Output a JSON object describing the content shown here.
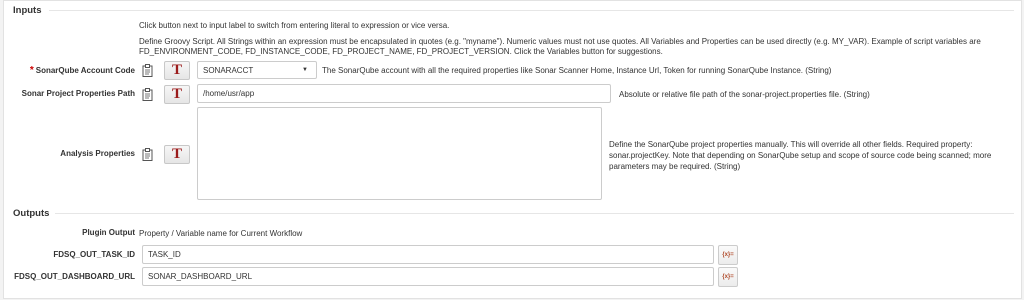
{
  "inputs": {
    "title": "Inputs",
    "help_line1": "Click button next to input label to switch from entering literal to expression or vice versa.",
    "help_line2": "Define Groovy Script. All Strings within an expression must be encapsulated in quotes (e.g. \"myname\"). Numeric values must not use quotes. All Variables and Properties can be used directly (e.g. MY_VAR). Example of script variables are",
    "help_line3": "FD_ENVIRONMENT_CODE, FD_INSTANCE_CODE, FD_PROJECT_NAME, FD_PROJECT_VERSION. Click the Variables button for suggestions.",
    "required_marker": "*",
    "account": {
      "label": "SonarQube Account Code",
      "value": "SONARACCT",
      "description": "The SonarQube account with all the required properties like Sonar Scanner Home, Instance Url, Token for running SonarQube Instance. (String)"
    },
    "properties_path": {
      "label": "Sonar Project Properties Path",
      "value": "/home/usr/app",
      "description": "Absolute or relative file path of the sonar-project.properties file. (String)"
    },
    "analysis": {
      "label": "Analysis Properties",
      "value": "",
      "description_line1": "Define the SonarQube project properties manually. This will override all other fields. Required property:",
      "description_line2": "sonar.projectKey. Note that depending on SonarQube setup and scope of source code being scanned; more",
      "description_line3": "parameters may be required. (String)"
    },
    "literal_toggle_glyph": "T"
  },
  "outputs": {
    "title": "Outputs",
    "plugin_output_label": "Plugin Output",
    "plugin_output_text": "Property / Variable name for Current Workflow",
    "task_id": {
      "label": "FDSQ_OUT_TASK_ID",
      "value": "TASK_ID"
    },
    "dashboard_url": {
      "label": "FDSQ_OUT_DASHBOARD_URL",
      "value": "SONAR_DASHBOARD_URL"
    },
    "variable_button_glyph": "{x}="
  },
  "icons": {
    "clipboard": "clipboard-icon",
    "literal_toggle": "literal-expression-toggle-icon",
    "dropdown": "chevron-down-icon",
    "variables": "variables-icon"
  }
}
